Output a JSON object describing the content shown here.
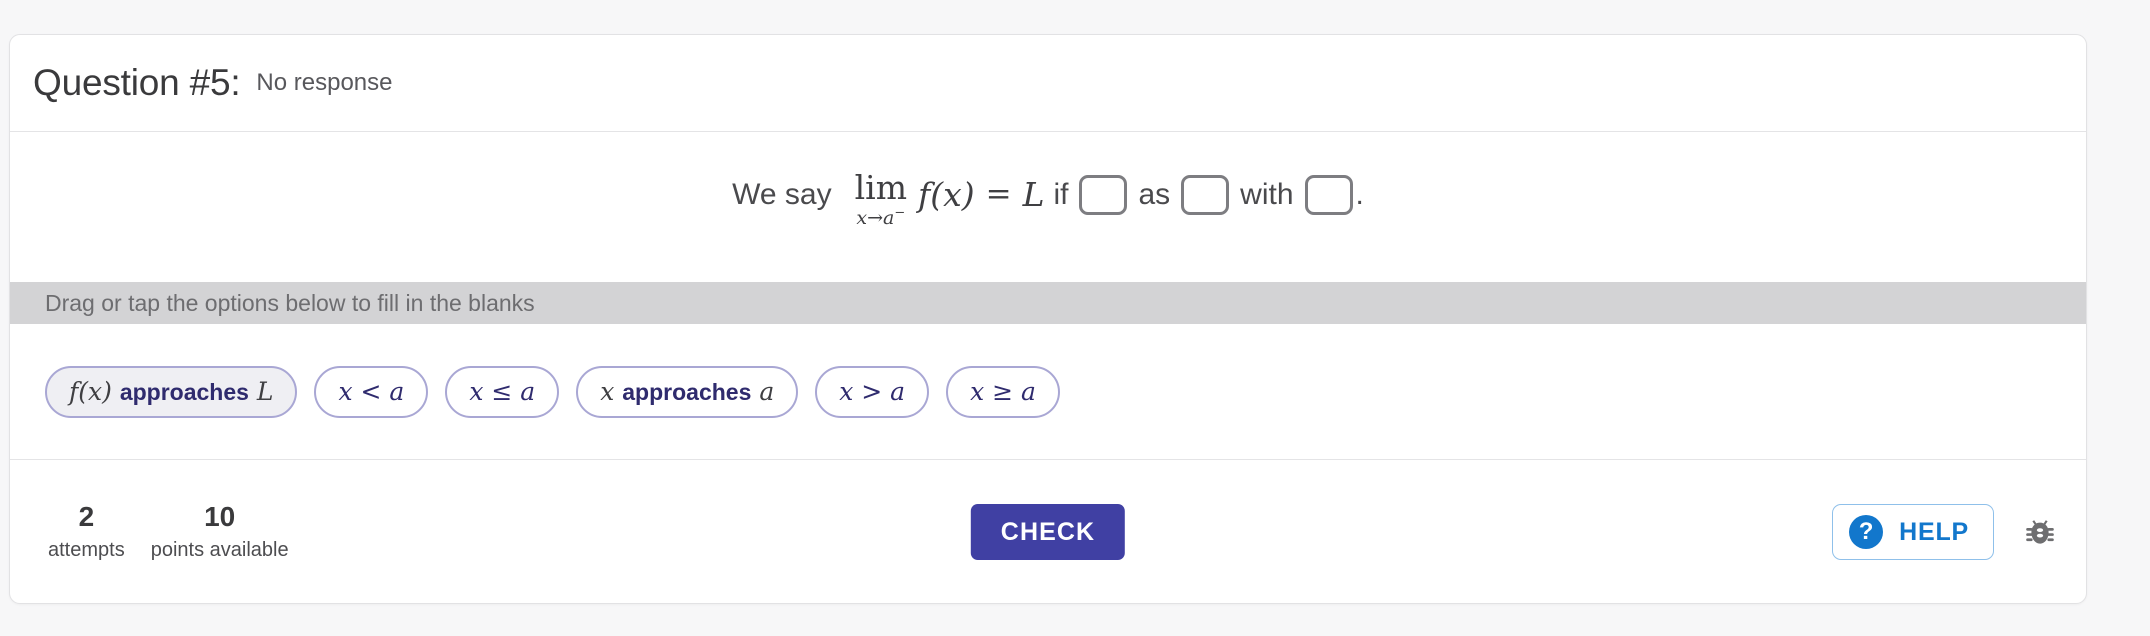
{
  "card": {
    "header": {
      "title": "Question #5:",
      "response_status": "No response"
    },
    "prompt": {
      "lead_text": "We say",
      "limit_operator": "lim",
      "limit_subscript_var": "x",
      "limit_subscript_arrow": "→",
      "limit_subscript_target": "a",
      "limit_subscript_side": "−",
      "function": "f(x)",
      "equals": "=",
      "limit_value": "L",
      "connector_if": "if",
      "connector_as": "as",
      "connector_with": "with",
      "terminator": ".",
      "blank_1_value": "",
      "blank_2_value": "",
      "blank_3_value": ""
    },
    "instruction": "Drag or tap the options below to fill in the blanks",
    "options": [
      {
        "id": "opt-fx-approaches-L",
        "math": "f(x)",
        "bold": "approaches",
        "tail": "L",
        "tinted": true
      },
      {
        "id": "opt-x-lt-a",
        "math": "x < a",
        "bold": "",
        "tail": "",
        "tinted": false
      },
      {
        "id": "opt-x-le-a",
        "math": "x ≤ a",
        "bold": "",
        "tail": "",
        "tinted": false
      },
      {
        "id": "opt-x-approaches-a",
        "math": "x",
        "bold": "approaches",
        "tail": "a",
        "tinted": false
      },
      {
        "id": "opt-x-gt-a",
        "math": "x > a",
        "bold": "",
        "tail": "",
        "tinted": false
      },
      {
        "id": "opt-x-ge-a",
        "math": "x ≥ a",
        "bold": "",
        "tail": "",
        "tinted": false
      }
    ],
    "footer": {
      "attempts_count": "2",
      "attempts_label": "attempts",
      "points_count": "10",
      "points_label": "points available",
      "check_label": "CHECK",
      "help_label": "HELP",
      "help_icon_glyph": "?",
      "help_icon_name": "question-circle-icon",
      "bug_icon_name": "bug-icon"
    }
  },
  "colors": {
    "page_background": "#f7f7f8",
    "card_background": "#ffffff",
    "card_border": "#e2e2e4",
    "instruction_bar": "#d3d3d5",
    "chip_border": "#a9a7d4",
    "chip_text": "#2f2b6e",
    "chip_tinted_background": "#efeff3",
    "check_button": "#4040a3",
    "help_accent": "#1277cc",
    "blank_border": "#7d7d81",
    "bug_icon": "#6e6e70"
  }
}
